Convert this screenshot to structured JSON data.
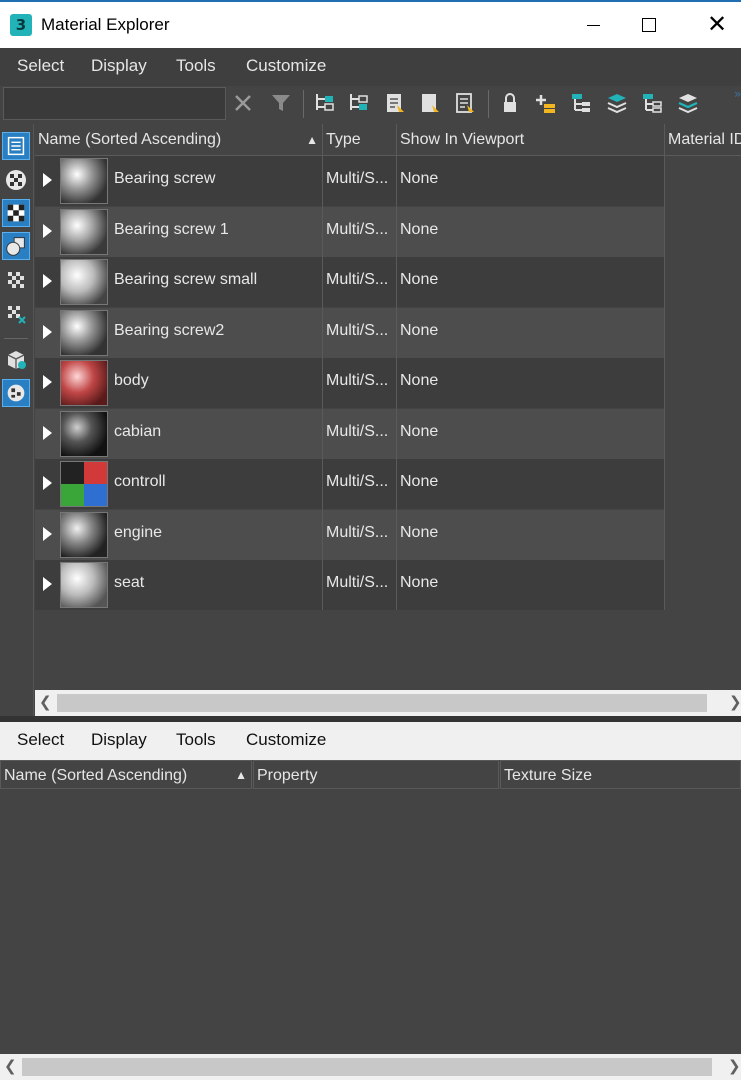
{
  "window": {
    "title": "Material Explorer",
    "app_icon_text": "3",
    "accent": "#22b3b8"
  },
  "top_menu": [
    "Select",
    "Display",
    "Tools",
    "Customize"
  ],
  "search": {
    "value": ""
  },
  "toolbar_icons": [
    "clear-search-icon",
    "filter-icon",
    "hierarchy-icon-1",
    "hierarchy-icon-2",
    "document-icon-1",
    "document-icon-2",
    "document-icon-3",
    "lock-icon",
    "add-layer-icon",
    "hierarchy-icon-3",
    "layers-icon-1",
    "hierarchy-icon-4",
    "layers-icon-2"
  ],
  "side_icons": [
    "tree-view-icon",
    "material-sphere-icon",
    "checker-map-icon",
    "shapes-icon",
    "checker-small-icon",
    "checker-x-icon",
    "object-icon",
    "globe-material-icon"
  ],
  "table": {
    "columns": {
      "name": "Name (Sorted Ascending)",
      "type": "Type",
      "viewport": "Show In Viewport",
      "material_id": "Material ID"
    },
    "rows": [
      {
        "name": "Bearing screw",
        "type": "Multi/S...",
        "viewport": "None"
      },
      {
        "name": "Bearing screw 1",
        "type": "Multi/S...",
        "viewport": "None"
      },
      {
        "name": "Bearing screw small",
        "type": "Multi/S...",
        "viewport": "None"
      },
      {
        "name": "Bearing screw2",
        "type": "Multi/S...",
        "viewport": "None"
      },
      {
        "name": "body",
        "type": "Multi/S...",
        "viewport": "None"
      },
      {
        "name": "cabian",
        "type": "Multi/S...",
        "viewport": "None"
      },
      {
        "name": "controll",
        "type": "Multi/S...",
        "viewport": "None"
      },
      {
        "name": "engine",
        "type": "Multi/S...",
        "viewport": "None"
      },
      {
        "name": "seat",
        "type": "Multi/S...",
        "viewport": "None"
      }
    ]
  },
  "bottom_menu": [
    "Select",
    "Display",
    "Tools",
    "Customize"
  ],
  "bottom_table": {
    "columns": {
      "name": "Name (Sorted Ascending)",
      "property": "Property",
      "texture_size": "Texture Size"
    }
  }
}
